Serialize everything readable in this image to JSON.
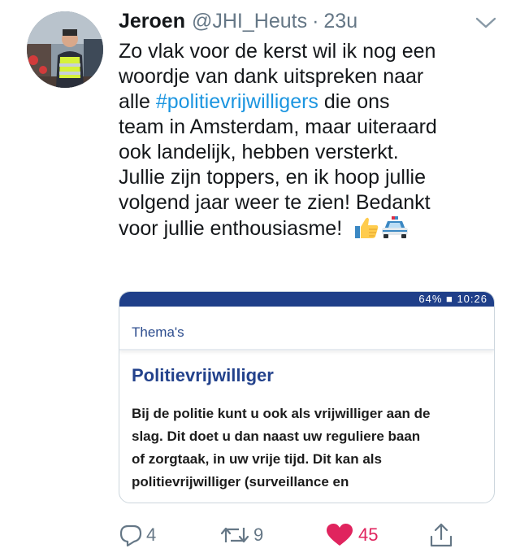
{
  "tweet": {
    "author_name": "Jeroen",
    "author_handle": "@JHI_Heuts",
    "separator": "·",
    "timestamp": "23u",
    "text_lines": [
      "Zo vlak voor de kerst wil ik nog een",
      "woordje van dank uitspreken naar"
    ],
    "text_line3_prefix": "alle ",
    "hashtag": "#politievrijwilligers",
    "text_line3_suffix": " die ons",
    "text_lines_rest": [
      "team in Amsterdam, maar uiteraard",
      "ook landelijk, hebben versterkt.",
      "Jullie zijn toppers, en ik hoop jullie",
      "volgend jaar weer te zien! Bedankt"
    ],
    "text_last_line": "voor jullie enthousiasme! ",
    "emoji": [
      "thumbs-up-emoji",
      "police-car-emoji"
    ]
  },
  "card": {
    "status_bar": "64% ■ 10:26",
    "section_label": "Thema's",
    "title": "Politievrijwilliger",
    "body_lines": [
      "Bij de politie kunt u ook als vrijwilliger aan de",
      "slag. Dit doet u dan naast uw reguliere baan",
      "of zorgtaak, in uw vrije tijd. Dit kan als",
      "politievrijwilliger (surveillance en"
    ]
  },
  "actions": {
    "reply_count": "4",
    "retweet_count": "9",
    "like_count": "45",
    "icons": [
      "reply-icon",
      "retweet-icon",
      "heart-icon",
      "share-icon"
    ],
    "like_color": "#e0245e",
    "link_color": "#1b95e0"
  }
}
